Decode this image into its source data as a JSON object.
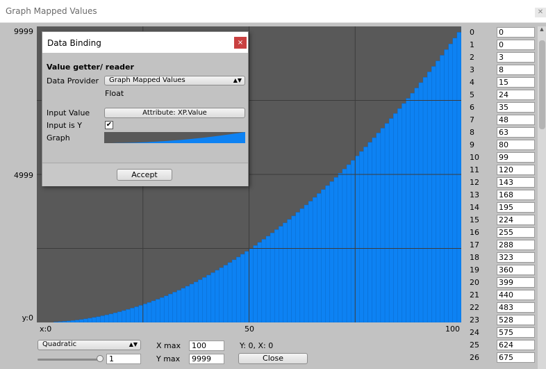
{
  "window": {
    "title": "Graph Mapped Values"
  },
  "graph": {
    "y_labels": {
      "top": "9999",
      "mid": "4999",
      "bottom": "y:0"
    },
    "x_labels": {
      "left": "x:0",
      "mid": "50",
      "right": "100"
    },
    "background_color": "#595959",
    "bar_color": "#0d82f3",
    "bar_edge_color": "#0a64c0",
    "grid_color": "#3c3c3c"
  },
  "chart_data": {
    "type": "bar",
    "x": [
      0,
      100
    ],
    "ylim": [
      0,
      9999
    ],
    "xlim": [
      0,
      100
    ],
    "curve": "quadratic",
    "grid": true
  },
  "controls": {
    "curve_select": "Quadratic",
    "slider_value": "1",
    "xmax_label": "X max",
    "xmax_value": "100",
    "ymax_label": "Y max",
    "ymax_value": "9999",
    "status": "Y: 0, X: 0",
    "close_label": "Close"
  },
  "table": {
    "rows": [
      {
        "i": "0",
        "v": "0"
      },
      {
        "i": "1",
        "v": "0"
      },
      {
        "i": "2",
        "v": "3"
      },
      {
        "i": "3",
        "v": "8"
      },
      {
        "i": "4",
        "v": "15"
      },
      {
        "i": "5",
        "v": "24"
      },
      {
        "i": "6",
        "v": "35"
      },
      {
        "i": "7",
        "v": "48"
      },
      {
        "i": "8",
        "v": "63"
      },
      {
        "i": "9",
        "v": "80"
      },
      {
        "i": "10",
        "v": "99"
      },
      {
        "i": "11",
        "v": "120"
      },
      {
        "i": "12",
        "v": "143"
      },
      {
        "i": "13",
        "v": "168"
      },
      {
        "i": "14",
        "v": "195"
      },
      {
        "i": "15",
        "v": "224"
      },
      {
        "i": "16",
        "v": "255"
      },
      {
        "i": "17",
        "v": "288"
      },
      {
        "i": "18",
        "v": "323"
      },
      {
        "i": "19",
        "v": "360"
      },
      {
        "i": "20",
        "v": "399"
      },
      {
        "i": "21",
        "v": "440"
      },
      {
        "i": "22",
        "v": "483"
      },
      {
        "i": "23",
        "v": "528"
      },
      {
        "i": "24",
        "v": "575"
      },
      {
        "i": "25",
        "v": "624"
      },
      {
        "i": "26",
        "v": "675"
      }
    ]
  },
  "dialog": {
    "title": "Data Binding",
    "close_icon": "×",
    "section": "Value getter/ reader",
    "provider_label": "Data Provider",
    "provider_value": "Graph Mapped Values",
    "type_text": "Float",
    "input_label": "Input Value",
    "input_value": "Attribute: XP.Value",
    "input_is_y_label": "Input is Y",
    "input_is_y_checked": true,
    "graph_label": "Graph",
    "accept_label": "Accept"
  }
}
